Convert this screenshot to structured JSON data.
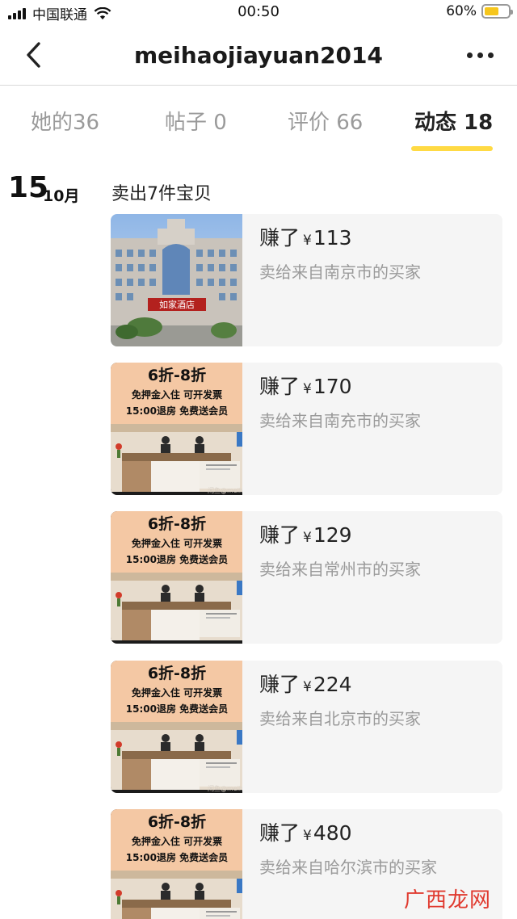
{
  "status_bar": {
    "carrier": "中国联通",
    "time": "00:50",
    "battery": "60%",
    "battery_level": 0.6
  },
  "nav": {
    "title": "meihaojiayuan2014",
    "back_icon": "chevron-left-icon",
    "more_icon": "more-dots-icon"
  },
  "tabs": [
    {
      "label": "她的36",
      "active": false
    },
    {
      "label": "帖子 0",
      "active": false
    },
    {
      "label": "评价 66",
      "active": false
    },
    {
      "label": "动态 18",
      "active": true
    }
  ],
  "accent_color": "#ffda44",
  "feed": {
    "day": "15",
    "month": "10月",
    "summary": "卖出7件宝贝",
    "items": [
      {
        "earn_prefix": "赚了",
        "currency": "¥",
        "amount": "113",
        "buyer": "卖给来自南京市的买家",
        "thumb": "hotel-exterior",
        "thumb_sign": "如家酒店"
      },
      {
        "earn_prefix": "赚了",
        "currency": "¥",
        "amount": "170",
        "buyer": "卖给来自南充市的买家",
        "thumb": "promo",
        "promo_l1": "6折-8折",
        "promo_l2": "免押金入住 可开发票",
        "promo_l3": "15:00退房 免费送会员",
        "promo_wm": "闲鱼@meihaojiay"
      },
      {
        "earn_prefix": "赚了",
        "currency": "¥",
        "amount": "129",
        "buyer": "卖给来自常州市的买家",
        "thumb": "promo",
        "promo_l1": "6折-8折",
        "promo_l2": "免押金入住 可开发票",
        "promo_l3": "15:00退房 免费送会员",
        "promo_wm": ""
      },
      {
        "earn_prefix": "赚了",
        "currency": "¥",
        "amount": "224",
        "buyer": "卖给来自北京市的买家",
        "thumb": "promo",
        "promo_l1": "6折-8折",
        "promo_l2": "免押金入住 可开发票",
        "promo_l3": "15:00退房 免费送会员",
        "promo_wm": "闲鱼@meihaojiay"
      },
      {
        "earn_prefix": "赚了",
        "currency": "¥",
        "amount": "480",
        "buyer": "卖给来自哈尔滨市的买家",
        "thumb": "promo",
        "promo_l1": "6折-8折",
        "promo_l2": "免押金入住 可开发票",
        "promo_l3": "15:00退房 免费送会员",
        "promo_wm": ""
      }
    ]
  },
  "watermark": "广西龙网"
}
